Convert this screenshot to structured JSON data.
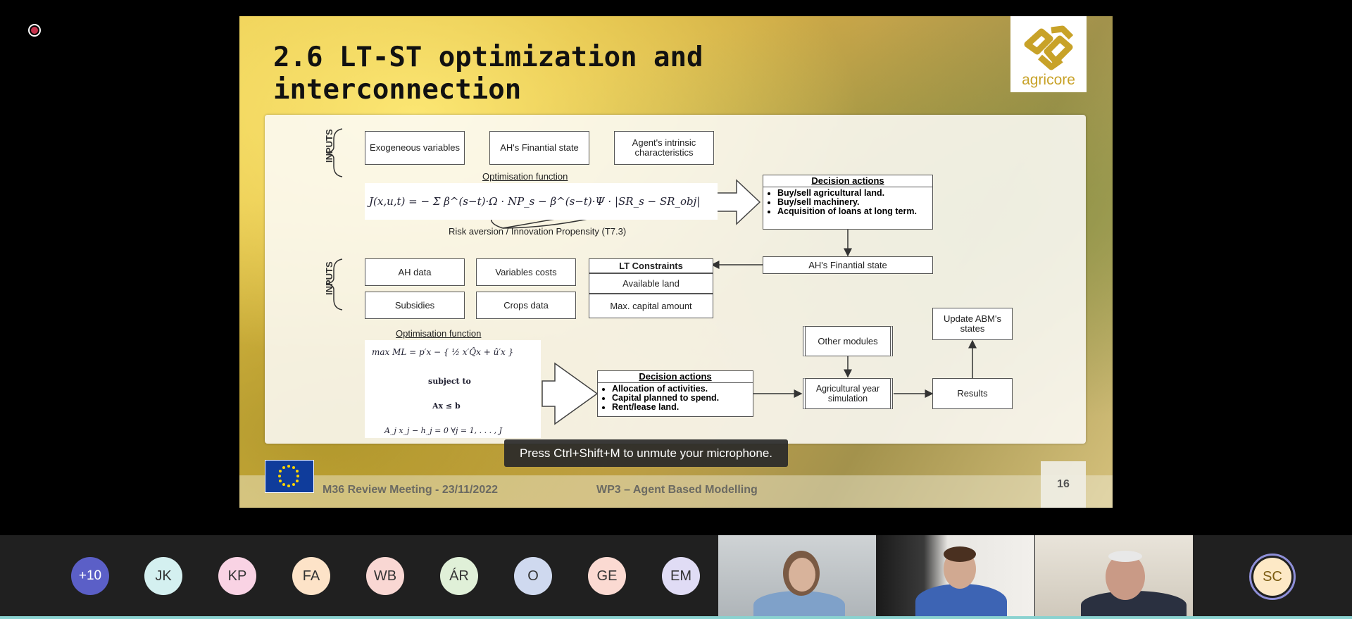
{
  "slide": {
    "title": "2.6 LT-ST optimization and\ninterconnection",
    "logo_text": "agricore",
    "footer_left": "M36 Review Meeting  - 23/11/2022",
    "footer_center": "WP3 – Agent Based Modelling",
    "page_number": "16"
  },
  "diagram": {
    "inputs_label": "INPUTS",
    "top_inputs": [
      "Exogeneous variables",
      "AH's Finantial state",
      "Agent's intrinsic characteristics"
    ],
    "opt_function_label": "Optimisation function",
    "lt_equation": "J(x,u,t) = − Σ β^(s−t)·Ω · NP_s − β^(s−t)·Ψ · |SR_s − SR_obj|",
    "risk_label": "Risk aversion / Innovation Propensity (T7.3)",
    "lt_decision_title": "Decision actions",
    "lt_decisions": [
      "Buy/sell agricultural land.",
      "Buy/sell machinery.",
      "Acquisition of loans at long term."
    ],
    "finantial_state": "AH's Finantial state",
    "bottom_inputs": [
      "AH data",
      "Variables costs",
      "Subsidies",
      "Crops data"
    ],
    "lt_constraints_title": "LT Constraints",
    "lt_constraints": [
      "Available land",
      "Max. capital amount"
    ],
    "st_opt_function_label": "Optimisation function",
    "st_eq_objective": "max ML = p′x − { ½ x′Q̂x + û′x }",
    "st_eq_subject": "subject to",
    "st_eq_constraint": "Ax ≤ b",
    "st_eq_last": "A_j x_j − h_j = 0   ∀j = 1, . . . , J",
    "st_decision_title": "Decision actions",
    "st_decisions": [
      "Allocation of activities.",
      "Capital planned to spend.",
      "Rent/lease land."
    ],
    "other_modules": "Other modules",
    "agri_sim": "Agricultural year simulation",
    "results": "Results",
    "update_states": "Update ABM's states"
  },
  "toast": "Press Ctrl+Shift+M to unmute your microphone.",
  "participants": {
    "more": "+10",
    "initials": [
      "JK",
      "KP",
      "FA",
      "WB",
      "ÁR",
      "O",
      "GE",
      "EM"
    ],
    "colors": [
      "#d4f0f0",
      "#f9d3e4",
      "#fde3c8",
      "#f9d7d3",
      "#e0f0d8",
      "#cfd9ef",
      "#fbdad2",
      "#e0dcf5"
    ],
    "active_speaker": "SC"
  }
}
